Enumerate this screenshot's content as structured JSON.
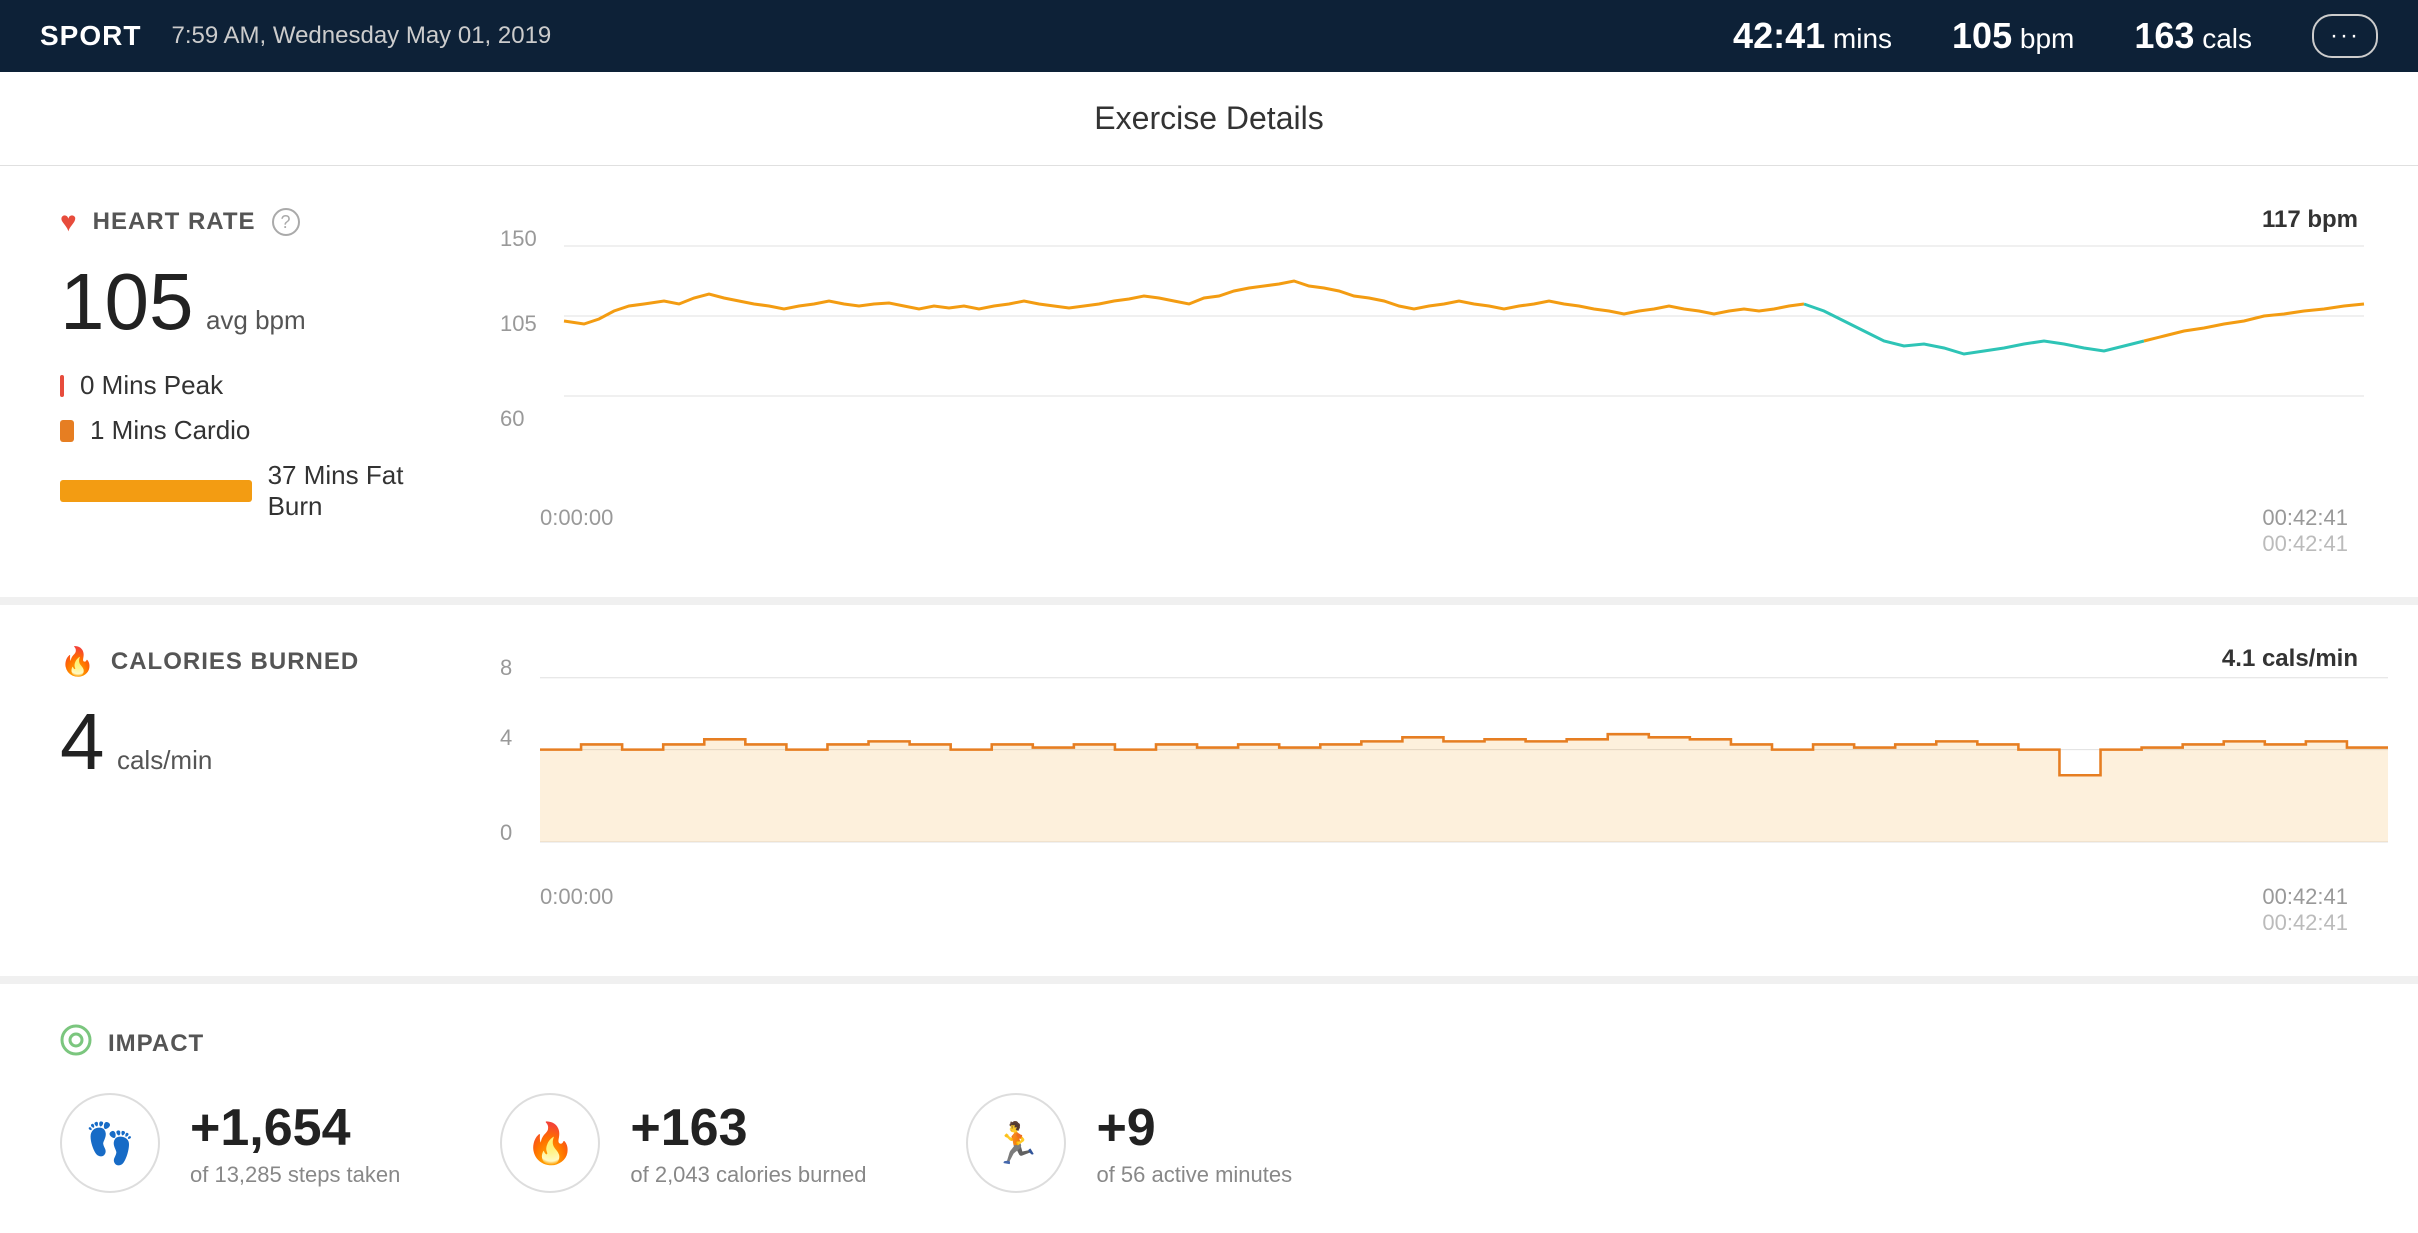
{
  "header": {
    "sport_label": "SPORT",
    "datetime": "7:59 AM, Wednesday May 01, 2019",
    "duration": "42:41",
    "duration_unit": "mins",
    "bpm": "105",
    "bpm_unit": "bpm",
    "calories": "163",
    "calories_unit": "cals",
    "more_icon": "···"
  },
  "page_title": "Exercise Details",
  "heart_rate": {
    "section_title": "HEART RATE",
    "avg_value": "105",
    "avg_unit": "avg bpm",
    "zones": [
      {
        "name": "0 Mins Peak",
        "color": "#e74c3c",
        "width": 0
      },
      {
        "name": "1 Mins Cardio",
        "color": "#e67e22",
        "width": 8
      },
      {
        "name": "37 Mins Fat Burn",
        "color": "#f39c12",
        "width": 180
      }
    ],
    "chart_y_labels": [
      "150",
      "105",
      "60"
    ],
    "chart_x_start": "0:00:00",
    "chart_x_end": "00:42:41",
    "chart_x_end2": "00:42:41",
    "peak_label": "117 bpm"
  },
  "calories_burned": {
    "section_title": "CALORIES BURNED",
    "value": "4",
    "unit": "cals/min",
    "chart_y_labels": [
      "8",
      "4",
      "0"
    ],
    "chart_x_start": "0:00:00",
    "chart_x_end": "00:42:41",
    "chart_x_end2": "00:42:41",
    "peak_label": "4.1 cals/min"
  },
  "impact": {
    "section_title": "IMPACT",
    "items": [
      {
        "icon": "👣",
        "value": "+1,654",
        "sub": "of 13,285 steps taken"
      },
      {
        "icon": "🔥",
        "value": "+163",
        "sub": "of 2,043 calories burned"
      },
      {
        "icon": "🏃",
        "value": "+9",
        "sub": "of 56 active minutes"
      }
    ]
  }
}
